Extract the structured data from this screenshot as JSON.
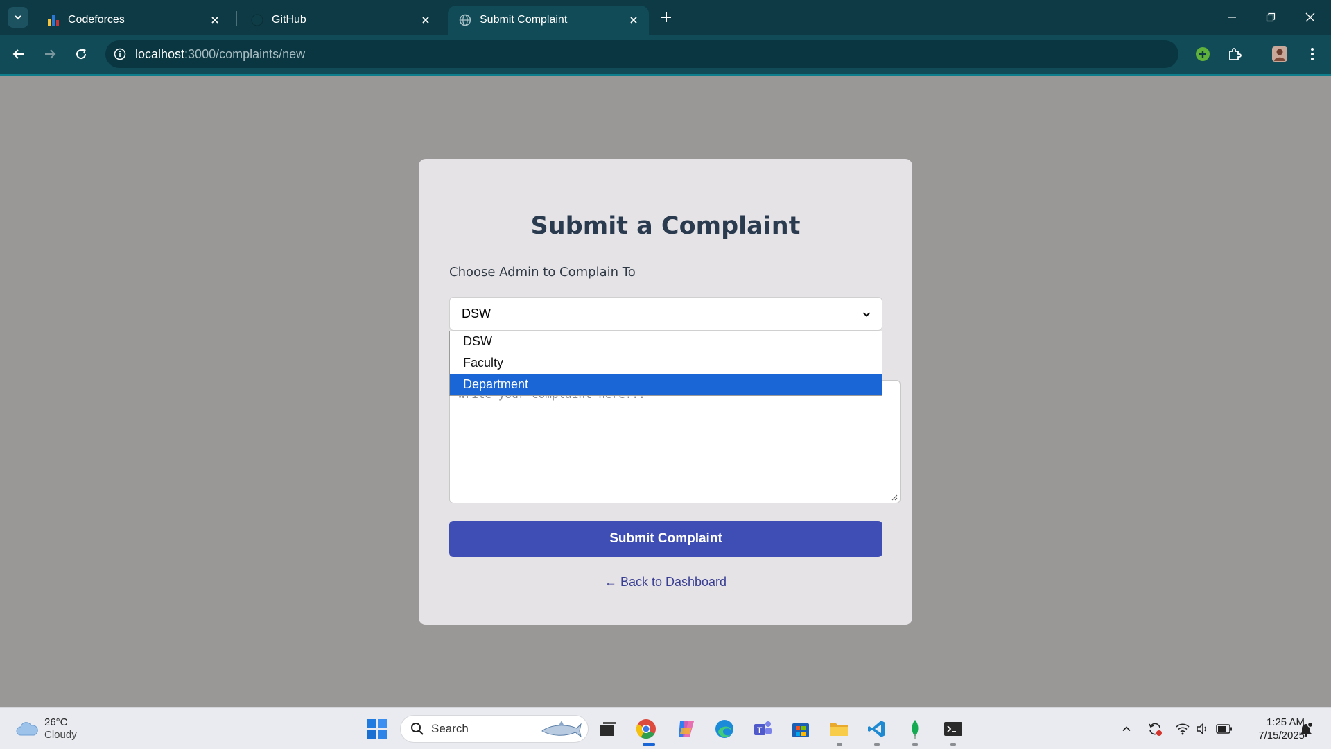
{
  "browser": {
    "tabs": [
      {
        "title": "Codeforces",
        "active": false
      },
      {
        "title": "GitHub",
        "active": false
      },
      {
        "title": "Submit Complaint",
        "active": true
      }
    ],
    "url_host": "localhost",
    "url_path": ":3000/complaints/new"
  },
  "page": {
    "title": "Submit a Complaint",
    "admin_label": "Choose Admin to Complain To",
    "admin_select_value": "DSW",
    "admin_options": [
      "DSW",
      "Faculty",
      "Department"
    ],
    "highlighted_option": "Department",
    "complaint_placeholder": "Write your complaint here...",
    "submit_label": "Submit Complaint",
    "back_link": "← Back to Dashboard",
    "colors": {
      "primary": "#3f4eb5",
      "title": "#2b3b4f",
      "highlight": "#1a66d6"
    }
  },
  "taskbar": {
    "weather_temp": "26°C",
    "weather_desc": "Cloudy",
    "search_label": "Search",
    "time": "1:25 AM",
    "date": "7/15/2025"
  }
}
